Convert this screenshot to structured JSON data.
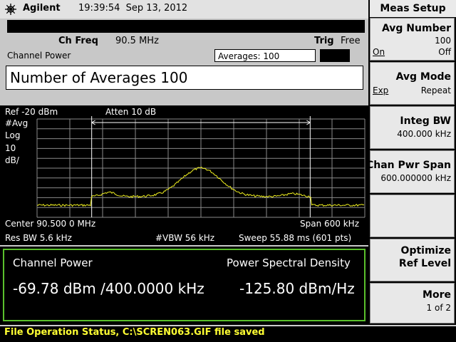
{
  "header": {
    "brand": "Agilent",
    "time": "19:39:54",
    "date": "Sep 13, 2012"
  },
  "measurement": {
    "ch_freq_label": "Ch Freq",
    "ch_freq_value": "90.5 MHz",
    "trig_label": "Trig",
    "trig_value": "Free",
    "name": "Channel Power",
    "averages_display": "Averages: 100",
    "entry_text": "Number of Averages 100"
  },
  "trace": {
    "ref": "Ref -20 dBm",
    "atten": "Atten 10 dB",
    "avg": "#Avg",
    "scale_type": "Log",
    "scale_value": "10",
    "scale_unit": "dB/",
    "center": "Center 90.500 0 MHz",
    "span": "Span 600 kHz",
    "res_bw": "Res BW 5.6 kHz",
    "vbw": "#VBW 56 kHz",
    "sweep": "Sweep 55.88 ms (601 pts)",
    "trace_color": "#f0f020",
    "grid_color": "#8a8a8a"
  },
  "results": {
    "channel_power_label": "Channel Power",
    "channel_power_value": "-69.78 dBm /400.0000 kHz",
    "psd_label": "Power Spectral Density",
    "psd_value": "-125.80 dBm/Hz",
    "border_color": "#5ac02c"
  },
  "status": {
    "text": "File Operation Status, C:\\SCREN063.GIF file saved"
  },
  "softkeys": {
    "title": "Meas Setup",
    "avg_number": {
      "label": "Avg Number",
      "value": "100",
      "on": "On",
      "off": "Off"
    },
    "avg_mode": {
      "label": "Avg Mode",
      "left": "Exp",
      "right": "Repeat"
    },
    "integ_bw": {
      "label": "Integ BW",
      "value": "400.000 kHz"
    },
    "chan_pwr_span": {
      "label": "Chan Pwr Span",
      "value": "600.000000 kHz"
    },
    "optimize": {
      "line1": "Optimize",
      "line2": "Ref Level"
    },
    "more": {
      "label": "More",
      "value": "1 of 2"
    }
  }
}
